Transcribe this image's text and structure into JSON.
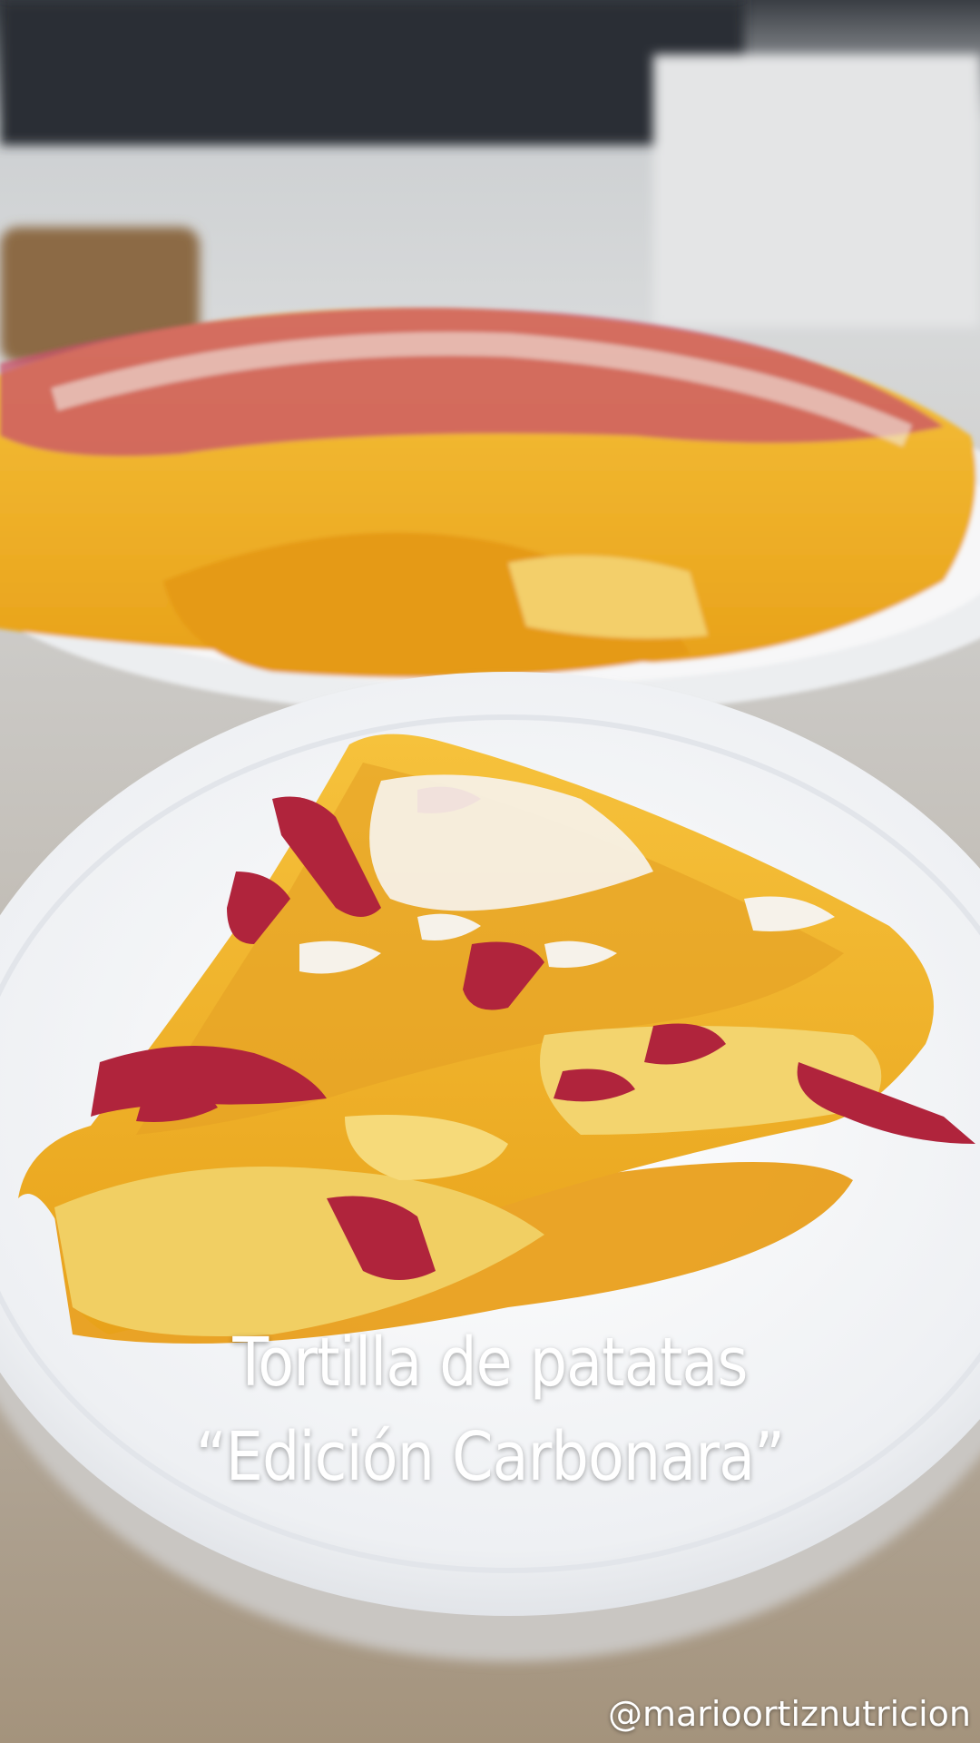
{
  "overlay": {
    "title_line1": "Tortilla de patatas",
    "title_line2": "“Edición Carbonara”",
    "handle": "@marioortiznutricion"
  },
  "colors": {
    "background": "#9a8f84",
    "plate": "#f4f5f7",
    "egg": "#f0b22a",
    "yolk_sauce": "#e89a10",
    "cured_meat": "#b0243c",
    "cheese": "#f6f2ea",
    "text": "#ffffff"
  }
}
